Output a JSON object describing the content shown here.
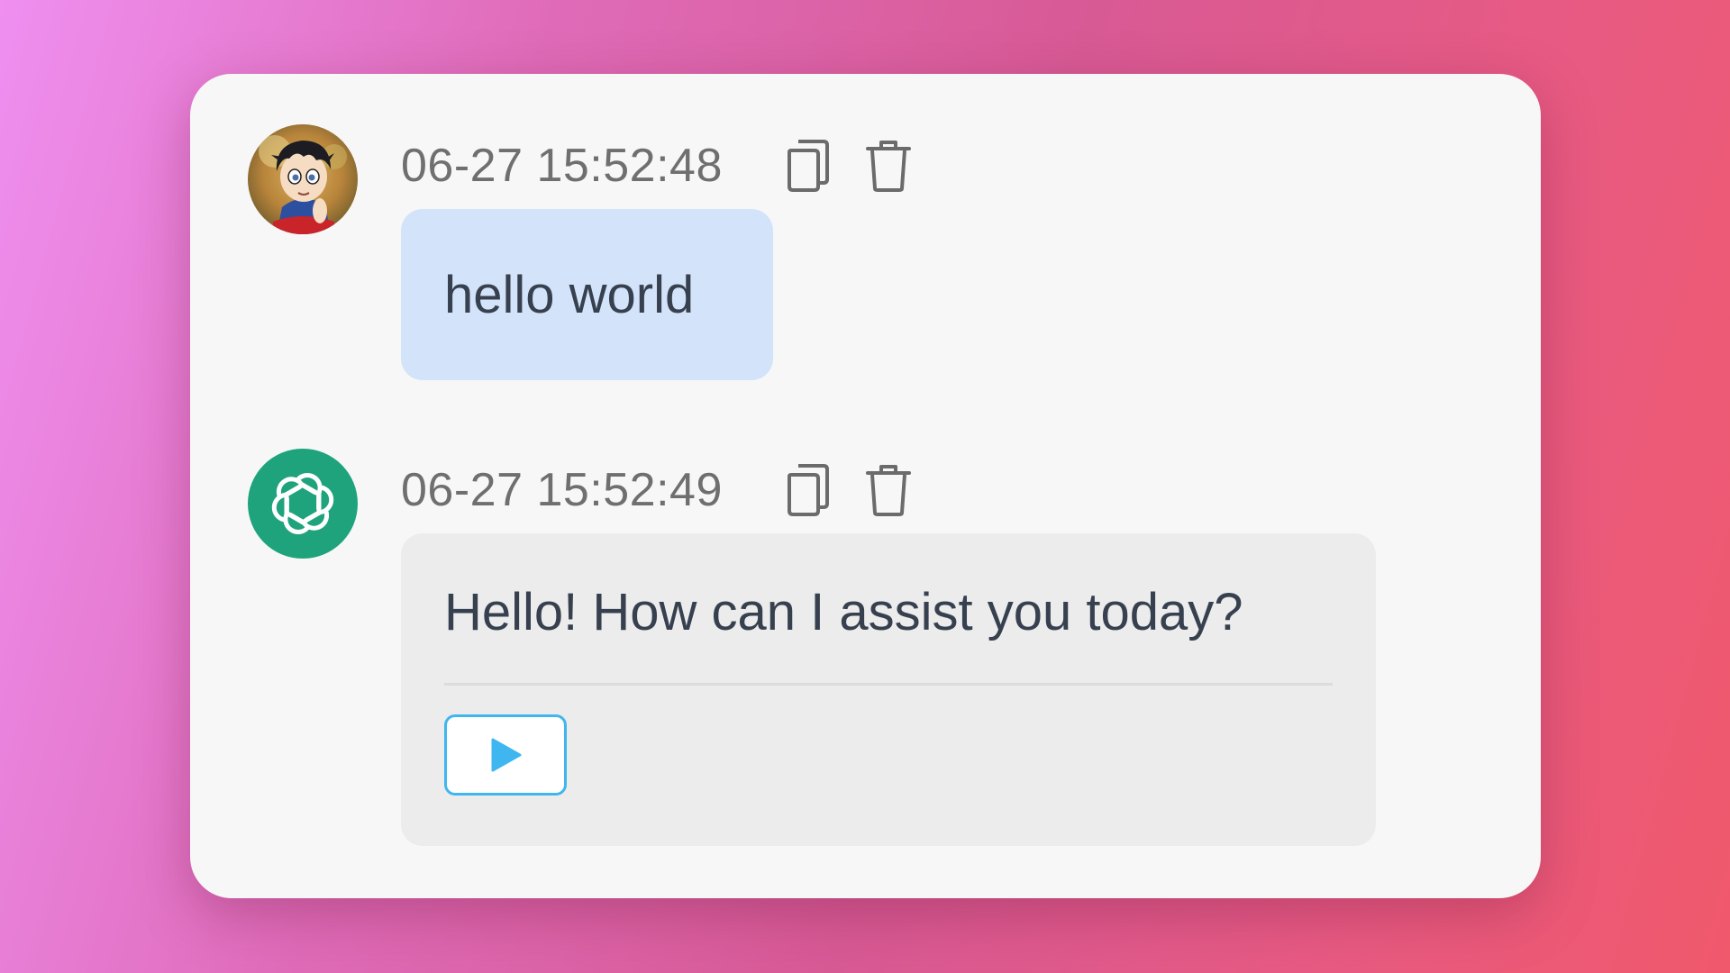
{
  "messages": [
    {
      "role": "user",
      "avatar_icon": "user-avatar",
      "timestamp": "06-27 15:52:48",
      "text": "hello world",
      "actions": [
        "copy-icon",
        "trash-icon"
      ]
    },
    {
      "role": "assistant",
      "avatar_icon": "openai-logo-icon",
      "timestamp": "06-27 15:52:49",
      "text": "Hello! How can I assist you today?",
      "actions": [
        "copy-icon",
        "trash-icon"
      ],
      "extra_action_icon": "play-icon"
    }
  ],
  "colors": {
    "user_bubble": "#d3e3fa",
    "assistant_bubble": "#ececec",
    "assistant_avatar": "#1fa37c",
    "play_accent": "#3fb6ef",
    "card_background": "#f7f7f7"
  }
}
